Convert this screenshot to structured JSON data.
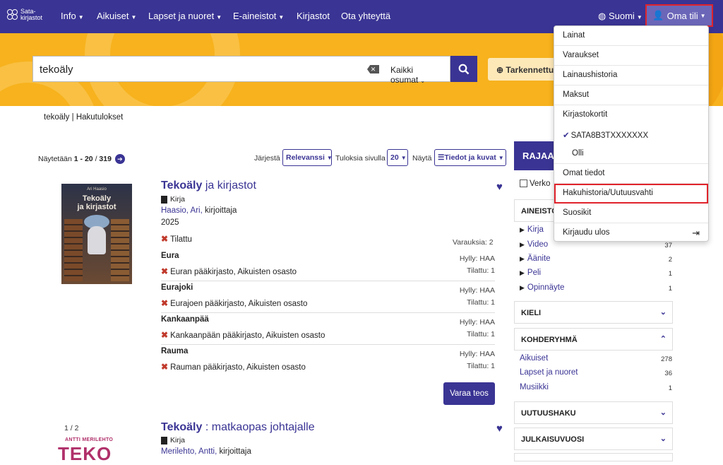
{
  "brand": {
    "logo_text_line1": "Sata-",
    "logo_text_line2": "kirjastot"
  },
  "nav": {
    "items": [
      {
        "label": "Info"
      },
      {
        "label": "Aikuiset"
      },
      {
        "label": "Lapset ja nuoret"
      },
      {
        "label": "E-aineistot"
      },
      {
        "label": "Kirjastot"
      },
      {
        "label": "Ota yhteyttä"
      }
    ],
    "language": "Suomi",
    "account": "Oma tili"
  },
  "search": {
    "query": "tekoäly",
    "scope": "Kaikki osumat",
    "refine_label": "Tarkennettu"
  },
  "breadcrumb": "tekoäly | Hakutulokset",
  "results_bar": {
    "showing_prefix": "Näytetään",
    "range": "1 - 20",
    "separator": "/",
    "total": "319",
    "sort_label": "Järjestä",
    "sort_value": "Relevanssi",
    "per_page_label": "Tuloksia sivulla",
    "per_page_value": "20",
    "view_label": "Näytä",
    "view_value": "Tiedot ja kuvat"
  },
  "results": [
    {
      "title_main": "Tekoäly",
      "title_rest": "ja kirjastot",
      "format": "Kirja",
      "author": "Haasio, Ari,",
      "role": "kirjoittaja",
      "year": "2025",
      "cover_author": "Ari Haasio",
      "cover_title_1": "Tekoäly",
      "cover_title_2": "ja kirjastot",
      "status": "Tilattu",
      "holds": "Varauksia: 2",
      "availability": [
        {
          "municipality": "Eura",
          "location": "Euran pääkirjasto, Aikuisten osasto",
          "shelf": "Hylly: HAA",
          "count": "Tilattu: 1"
        },
        {
          "municipality": "Eurajoki",
          "location": "Eurajoen pääkirjasto, Aikuisten osasto",
          "shelf": "Hylly: HAA",
          "count": "Tilattu: 1"
        },
        {
          "municipality": "Kankaanpää",
          "location": "Kankaanpään pääkirjasto, Aikuisten osasto",
          "shelf": "Hylly: HAA",
          "count": "Tilattu: 1"
        },
        {
          "municipality": "Rauma",
          "location": "Rauman pääkirjasto, Aikuisten osasto",
          "shelf": "Hylly: HAA",
          "count": "Tilattu: 1"
        }
      ],
      "reserve_label": "Varaa teos"
    },
    {
      "title_main": "Tekoäly",
      "title_rest": ": matkaopas johtajalle",
      "format": "Kirja",
      "author": "Merilehto, Antti,",
      "role": "kirjoittaja",
      "cover_pager": "1 / 2",
      "cover_author": "ANTTI MERILEHTO",
      "cover_title": "TEKO"
    }
  ],
  "sidebar": {
    "heading": "RAJAA",
    "verkko_label": "Verko",
    "facets": {
      "aineisto": {
        "label": "AINEISTO",
        "items": [
          {
            "label": "Kirja",
            "count": ""
          },
          {
            "label": "Video",
            "count": "37"
          },
          {
            "label": "Äänite",
            "count": "2"
          },
          {
            "label": "Peli",
            "count": "1"
          },
          {
            "label": "Opinnäyte",
            "count": "1"
          }
        ]
      },
      "kieli": {
        "label": "KIELI"
      },
      "kohderyhma": {
        "label": "KOHDERYHMÄ",
        "items": [
          {
            "label": "Aikuiset",
            "count": "278"
          },
          {
            "label": "Lapset ja nuoret",
            "count": "36"
          },
          {
            "label": "Musiikki",
            "count": "1"
          }
        ]
      },
      "uutuushaku": {
        "label": "UUTUUSHAKU"
      },
      "julkaisuvuosi": {
        "label": "JULKAISUVUOSI"
      }
    }
  },
  "account_menu": {
    "items": {
      "loans": "Lainat",
      "holds": "Varaukset",
      "history": "Lainaushistoria",
      "fees": "Maksut",
      "cards": "Kirjastokortit",
      "card_id": "SATA8B3TXXXXXXX",
      "card_name": "Olli",
      "profile": "Omat tiedot",
      "search_history": "Hakuhistoria/Uutuusvahti",
      "favorites": "Suosikit",
      "logout": "Kirjaudu ulos"
    }
  }
}
